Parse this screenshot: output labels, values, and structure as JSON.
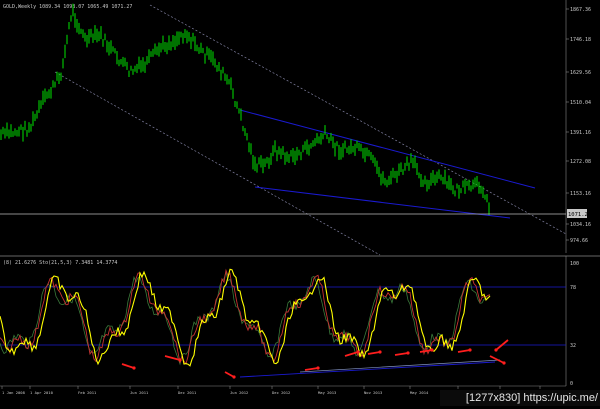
{
  "chart_data": [
    {
      "type": "candlestick",
      "symbol_header": "GOLD,Weekly  1089.34 1098.07 1065.49 1071.27",
      "price_axis_labels": [
        "1867.36",
        "1746.18",
        "1629.56",
        "1510.04",
        "1391.16",
        "1272.08",
        "1153.16",
        "1034.16",
        "974.66"
      ],
      "current_price_label": "1071.27",
      "ylim": [
        960,
        1880
      ],
      "colors": {
        "up": "#00d000",
        "down": "#00d000",
        "trend_channel": "#1a1ad0",
        "dotted_channel": "#8080a0"
      }
    },
    {
      "type": "line",
      "indicator_header": "(8) 21.6276  Sto(21,5,3) 7.3481 14.3774",
      "axis_labels": [
        "100",
        "78",
        "32",
        "0"
      ],
      "ylim": [
        0,
        100
      ],
      "series_colors": {
        "main": "#ffff00",
        "signal": "#c83232",
        "alt": "#3a7a3a",
        "overbought_line": "#1a1ad0"
      }
    }
  ],
  "time_axis_labels": [
    "1 Jan 2008",
    "1 Apr 2010",
    "Feb 2011",
    "Jun 2011",
    "Dec 2011",
    "Jun 2012",
    "Dec 2012",
    "May 2013",
    "Nov 2013",
    "May 2014",
    "Oct 2014",
    "May 2015",
    "Oct 2015"
  ],
  "watermark": "[1277x830] https://upic.me/",
  "annotation_color": "#ff1e1e",
  "icons": [
    "arrow-icon"
  ]
}
